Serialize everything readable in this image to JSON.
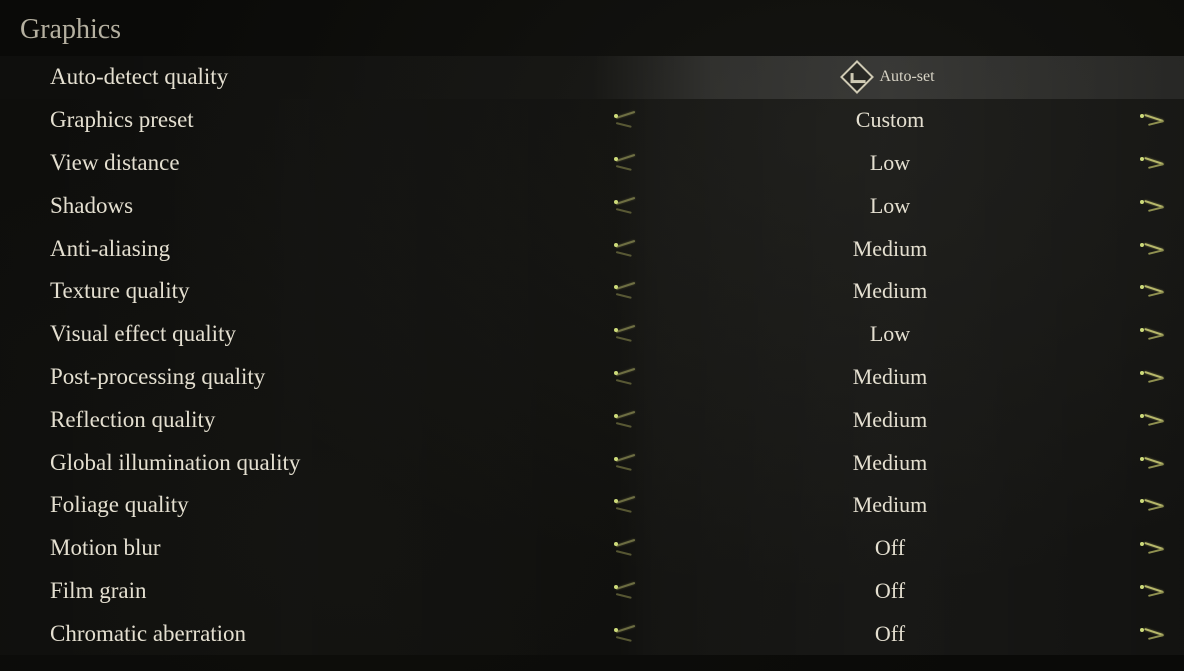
{
  "section_title": "Graphics",
  "auto_detect": {
    "label": "Auto-detect quality",
    "button_label": "Auto-set"
  },
  "settings": [
    {
      "id": "graphics-preset",
      "label": "Graphics preset",
      "value": "Custom"
    },
    {
      "id": "view-distance",
      "label": "View distance",
      "value": "Low"
    },
    {
      "id": "shadows",
      "label": "Shadows",
      "value": "Low"
    },
    {
      "id": "anti-aliasing",
      "label": "Anti-aliasing",
      "value": "Medium"
    },
    {
      "id": "texture-quality",
      "label": "Texture quality",
      "value": "Medium"
    },
    {
      "id": "visual-effect-quality",
      "label": "Visual effect quality",
      "value": "Low"
    },
    {
      "id": "post-processing",
      "label": "Post-processing quality",
      "value": "Medium"
    },
    {
      "id": "reflection-quality",
      "label": "Reflection quality",
      "value": "Medium"
    },
    {
      "id": "global-illumination",
      "label": "Global illumination quality",
      "value": "Medium"
    },
    {
      "id": "foliage-quality",
      "label": "Foliage quality",
      "value": "Medium"
    },
    {
      "id": "motion-blur",
      "label": "Motion blur",
      "value": "Off"
    },
    {
      "id": "film-grain",
      "label": "Film grain",
      "value": "Off"
    },
    {
      "id": "chromatic-aberration",
      "label": "Chromatic aberration",
      "value": "Off"
    }
  ],
  "colors": {
    "text": "#e4dfd0",
    "muted": "#b5b0a0",
    "accent": "#cddb7a",
    "background": "#0a0a08"
  }
}
